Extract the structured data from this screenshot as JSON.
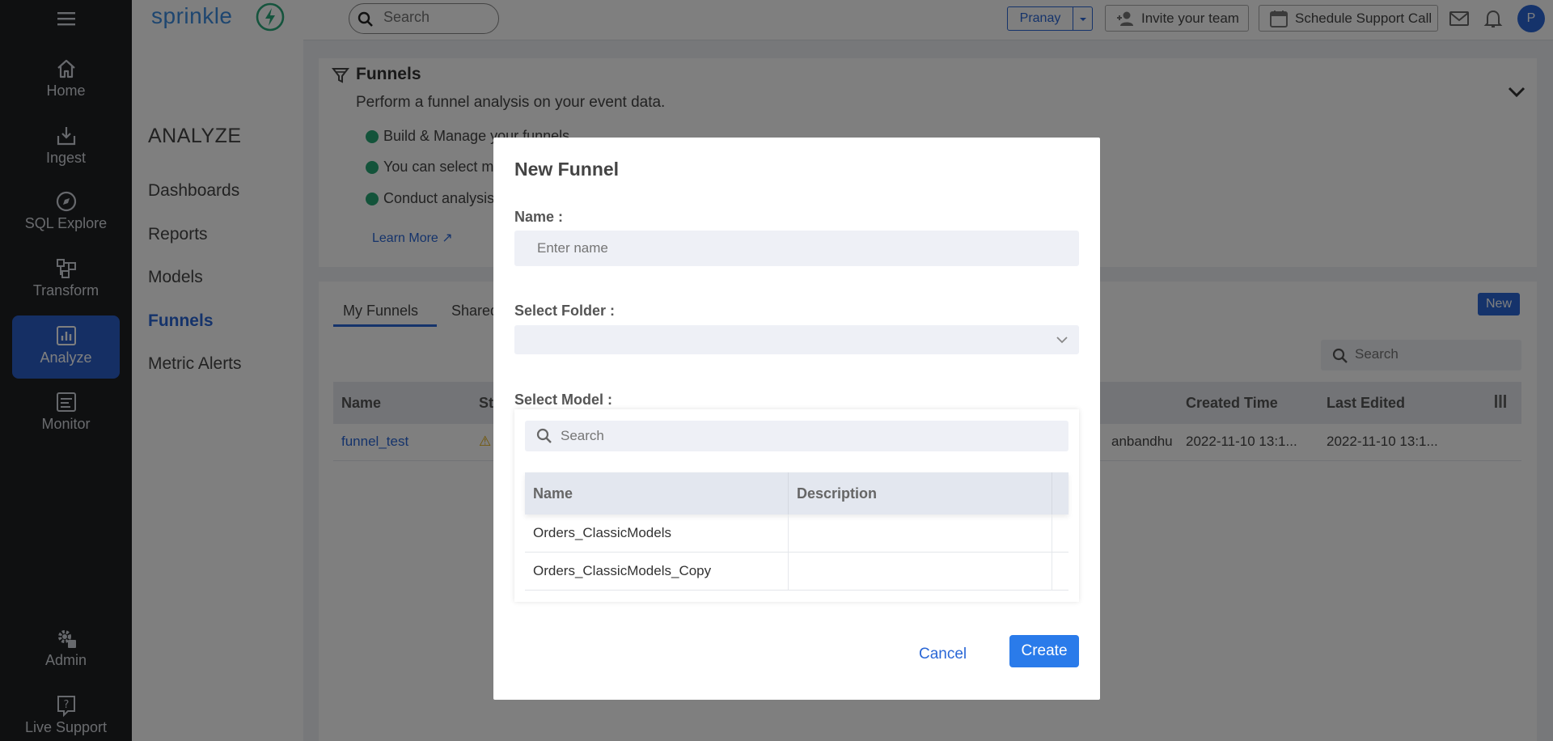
{
  "app": {
    "logo_text": "sprinkle"
  },
  "leftnav": {
    "items": [
      {
        "label": "Home",
        "icon": "home-icon"
      },
      {
        "label": "Ingest",
        "icon": "ingest-icon"
      },
      {
        "label": "SQL Explore",
        "icon": "compass-icon"
      },
      {
        "label": "Transform",
        "icon": "transform-icon"
      },
      {
        "label": "Analyze",
        "icon": "chart-icon",
        "active": true
      },
      {
        "label": "Monitor",
        "icon": "monitor-icon"
      },
      {
        "label": "Admin",
        "icon": "admin-gear-icon"
      },
      {
        "label": "Live Support",
        "icon": "help-icon"
      }
    ]
  },
  "subnav": {
    "heading": "ANALYZE",
    "items": [
      {
        "label": "Dashboards"
      },
      {
        "label": "Reports"
      },
      {
        "label": "Models"
      },
      {
        "label": "Funnels",
        "active": true
      },
      {
        "label": "Metric Alerts"
      }
    ]
  },
  "topbar": {
    "search_placeholder": "Search",
    "user_label": "Pranay",
    "invite_label": "Invite your team",
    "schedule_label": "Schedule Support Call",
    "avatar_initial": "P"
  },
  "info": {
    "title": "Funnels",
    "subtitle": "Perform a funnel analysis on your event data.",
    "bullets": [
      "Build & Manage your funnels",
      "You can select m",
      "Conduct analysis"
    ],
    "learn_more": "Learn More"
  },
  "list": {
    "tabs": [
      "My Funnels",
      "Shared"
    ],
    "new_label": "New",
    "search_placeholder": "Search",
    "columns": [
      "Name",
      "St",
      "Created Time",
      "Last Edited"
    ],
    "rows": [
      {
        "name": "funnel_test",
        "owner_fragment": "anbandhu",
        "created": "2022-11-10 13:1...",
        "edited": "2022-11-10 13:1..."
      }
    ]
  },
  "modal": {
    "title": "New Funnel",
    "name_label": "Name :",
    "name_placeholder": "Enter name",
    "folder_label": "Select Folder :",
    "model_label": "Select Model :",
    "model_search_placeholder": "Search",
    "model_columns": [
      "Name",
      "Description"
    ],
    "models": [
      {
        "name": "Orders_ClassicModels",
        "description": ""
      },
      {
        "name": "Orders_ClassicModels_Copy",
        "description": ""
      }
    ],
    "cancel_label": "Cancel",
    "create_label": "Create"
  },
  "colors": {
    "accent": "#2a67d6",
    "sidebar_bg": "#1f2023",
    "success": "#27a775"
  }
}
